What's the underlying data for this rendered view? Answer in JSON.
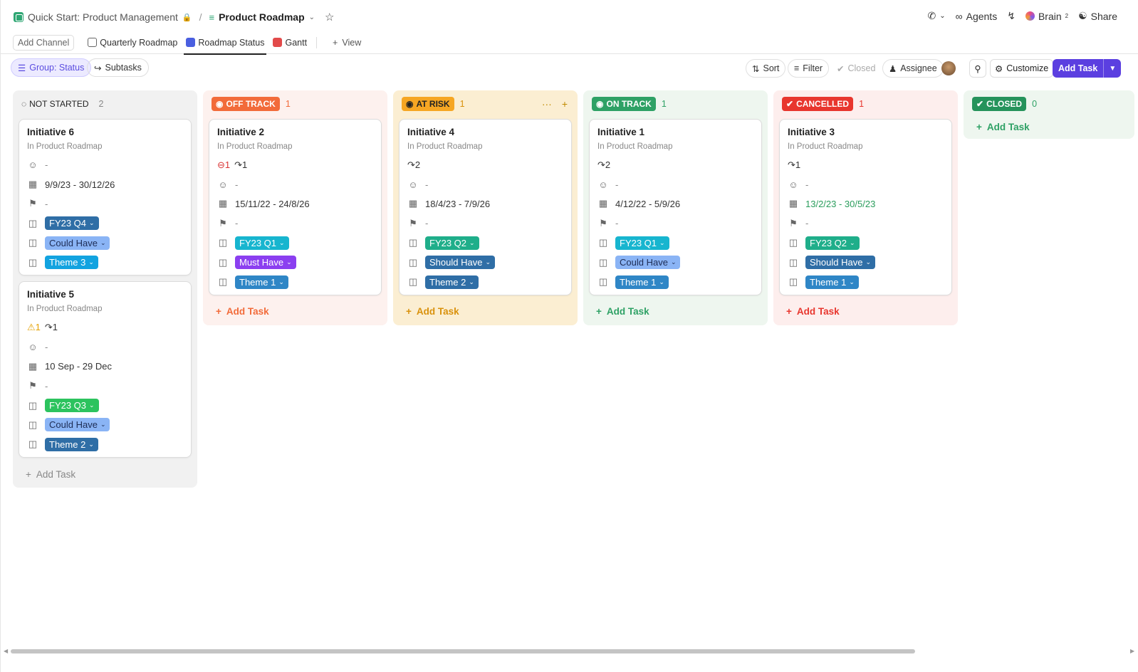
{
  "breadcrumb": {
    "space": "Quick Start: Product Management",
    "current": "Product Roadmap"
  },
  "topright": {
    "agents": "Agents",
    "brain": "Brain",
    "brain_sup": "2",
    "share": "Share"
  },
  "views": {
    "add_channel": "Add Channel",
    "tabs": [
      "Quarterly Roadmap",
      "Roadmap Status",
      "Gantt"
    ],
    "add_view": "View"
  },
  "toolbar": {
    "group": "Group: Status",
    "subtasks": "Subtasks",
    "sort": "Sort",
    "filter": "Filter",
    "closed": "Closed",
    "assignee": "Assignee",
    "customize": "Customize",
    "add_task": "Add Task"
  },
  "colors": {
    "not_started": "#f1f1f1",
    "off_track": "#fdf1ee",
    "at_risk": "#fbeed2",
    "on_track": "#eef6ef",
    "cancelled": "#fdeeed",
    "closed": "#eef6ef"
  },
  "columns": [
    {
      "name": "NOT STARTED",
      "count": "2",
      "add_task": "Add Task",
      "cards": [
        {
          "title": "Initiative 6",
          "sub": "In Product Roadmap",
          "assignee": "-",
          "dates": "9/9/23 - 30/12/26",
          "priority": "-",
          "tags": [
            "FY23 Q4",
            "Could Have",
            "Theme 3"
          ]
        },
        {
          "title": "Initiative 5",
          "sub": "In Product Roadmap",
          "warn": "1",
          "subtasks": "1",
          "assignee": "-",
          "dates": "10 Sep - 29 Dec",
          "priority": "-",
          "tags": [
            "FY23 Q3",
            "Could Have",
            "Theme 2"
          ]
        }
      ]
    },
    {
      "name": "OFF TRACK",
      "count": "1",
      "add_task": "Add Task",
      "cards": [
        {
          "title": "Initiative 2",
          "sub": "In Product Roadmap",
          "blocked": "1",
          "subtasks": "1",
          "assignee": "-",
          "dates": "15/11/22 - 24/8/26",
          "priority": "-",
          "tags": [
            "FY23 Q1",
            "Must Have",
            "Theme 1"
          ]
        }
      ]
    },
    {
      "name": "AT RISK",
      "count": "1",
      "add_task": "Add Task",
      "cards": [
        {
          "title": "Initiative 4",
          "sub": "In Product Roadmap",
          "subtasks": "2",
          "assignee": "-",
          "dates": "18/4/23 - 7/9/26",
          "priority": "-",
          "tags": [
            "FY23 Q2",
            "Should Have",
            "Theme 2"
          ]
        }
      ]
    },
    {
      "name": "ON TRACK",
      "count": "1",
      "add_task": "Add Task",
      "cards": [
        {
          "title": "Initiative 1",
          "sub": "In Product Roadmap",
          "subtasks": "2",
          "assignee": "-",
          "dates": "4/12/22 - 5/9/26",
          "priority": "-",
          "tags": [
            "FY23 Q1",
            "Could Have",
            "Theme 1"
          ]
        }
      ]
    },
    {
      "name": "CANCELLED",
      "count": "1",
      "add_task": "Add Task",
      "cards": [
        {
          "title": "Initiative 3",
          "sub": "In Product Roadmap",
          "subtasks": "1",
          "assignee": "-",
          "dates": "13/2/23 - 30/5/23",
          "priority": "-",
          "tags": [
            "FY23 Q2",
            "Should Have",
            "Theme 1"
          ]
        }
      ]
    },
    {
      "name": "CLOSED",
      "count": "0",
      "add_task": "Add Task",
      "cards": []
    }
  ]
}
